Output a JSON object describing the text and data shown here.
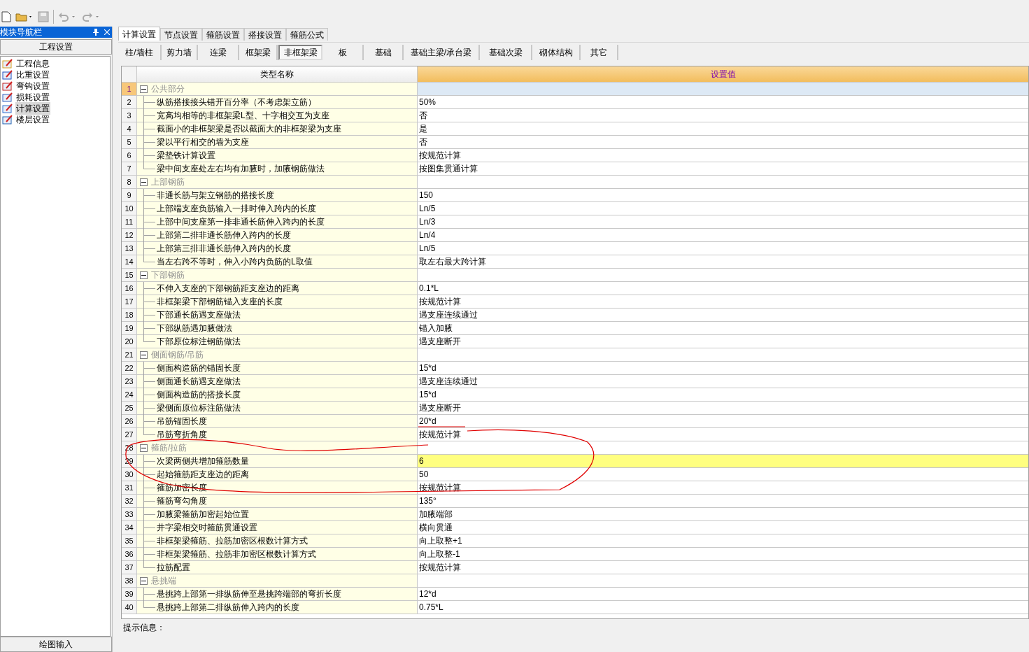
{
  "nav": {
    "title": "模块导航栏",
    "section": "工程设置",
    "items": [
      {
        "label": "工程信息",
        "selected": false
      },
      {
        "label": "比重设置",
        "selected": false
      },
      {
        "label": "弯钩设置",
        "selected": false
      },
      {
        "label": "损耗设置",
        "selected": false
      },
      {
        "label": "计算设置",
        "selected": true
      },
      {
        "label": "楼层设置",
        "selected": false
      }
    ],
    "bottom": "绘图输入"
  },
  "tabs": [
    {
      "label": "计算设置",
      "selected": true
    },
    {
      "label": "节点设置",
      "selected": false
    },
    {
      "label": "箍筋设置",
      "selected": false
    },
    {
      "label": "搭接设置",
      "selected": false
    },
    {
      "label": "箍筋公式",
      "selected": false
    }
  ],
  "subtabs": [
    {
      "label": "柱/墙柱",
      "selected": false
    },
    {
      "label": "剪力墙",
      "selected": false
    },
    {
      "label": "连梁",
      "selected": false
    },
    {
      "label": "框架梁",
      "selected": false
    },
    {
      "label": "非框架梁",
      "selected": true
    },
    {
      "label": "板",
      "selected": false
    },
    {
      "label": "基础",
      "selected": false
    },
    {
      "label": "基础主梁/承台梁",
      "selected": false
    },
    {
      "label": "基础次梁",
      "selected": false
    },
    {
      "label": "砌体结构",
      "selected": false
    },
    {
      "label": "其它",
      "selected": false
    }
  ],
  "grid": {
    "columns": [
      "类型名称",
      "设置值"
    ],
    "groups": [
      {
        "num": "1",
        "name": "公共部分",
        "expanded": true,
        "selected": true,
        "children": [
          {
            "num": "2",
            "name": "纵筋搭接接头错开百分率（不考虑架立筋）",
            "value": "50%",
            "selected": false
          },
          {
            "num": "3",
            "name": "宽高均相等的非框架梁L型、十字相交互为支座",
            "value": "否",
            "selected": false
          },
          {
            "num": "4",
            "name": "截面小的非框架梁是否以截面大的非框架梁为支座",
            "value": "是",
            "selected": false
          },
          {
            "num": "5",
            "name": "梁以平行相交的墙为支座",
            "value": "否",
            "selected": false
          },
          {
            "num": "6",
            "name": "梁垫铁计算设置",
            "value": "按规范计算",
            "selected": false
          },
          {
            "num": "7",
            "name": "梁中间支座处左右均有加腋时，加腋钢筋做法",
            "value": "按图集贯通计算",
            "selected": false
          }
        ]
      },
      {
        "num": "8",
        "name": "上部钢筋",
        "expanded": true,
        "selected": false,
        "children": [
          {
            "num": "9",
            "name": "非通长筋与架立钢筋的搭接长度",
            "value": "150",
            "selected": false
          },
          {
            "num": "10",
            "name": "上部端支座负筋输入一排时伸入跨内的长度",
            "value": "Ln/5",
            "selected": false
          },
          {
            "num": "11",
            "name": "上部中间支座第一排非通长筋伸入跨内的长度",
            "value": "Ln/3",
            "selected": false
          },
          {
            "num": "12",
            "name": "上部第二排非通长筋伸入跨内的长度",
            "value": "Ln/4",
            "selected": false
          },
          {
            "num": "13",
            "name": "上部第三排非通长筋伸入跨内的长度",
            "value": "Ln/5",
            "selected": false
          },
          {
            "num": "14",
            "name": "当左右跨不等时，伸入小跨内负筋的L取值",
            "value": "取左右最大跨计算",
            "selected": false
          }
        ]
      },
      {
        "num": "15",
        "name": "下部钢筋",
        "expanded": true,
        "selected": false,
        "children": [
          {
            "num": "16",
            "name": "不伸入支座的下部钢筋距支座边的距离",
            "value": "0.1*L",
            "selected": false
          },
          {
            "num": "17",
            "name": "非框架梁下部钢筋锚入支座的长度",
            "value": "按规范计算",
            "selected": false
          },
          {
            "num": "18",
            "name": "下部通长筋遇支座做法",
            "value": "遇支座连续通过",
            "selected": false
          },
          {
            "num": "19",
            "name": "下部纵筋遇加腋做法",
            "value": "锚入加腋",
            "selected": false
          },
          {
            "num": "20",
            "name": "下部原位标注钢筋做法",
            "value": "遇支座断开",
            "selected": false
          }
        ]
      },
      {
        "num": "21",
        "name": "侧面钢筋/吊筋",
        "expanded": true,
        "selected": false,
        "children": [
          {
            "num": "22",
            "name": "侧面构造筋的锚固长度",
            "value": "15*d",
            "selected": false
          },
          {
            "num": "23",
            "name": "侧面通长筋遇支座做法",
            "value": "遇支座连续通过",
            "selected": false
          },
          {
            "num": "24",
            "name": "侧面构造筋的搭接长度",
            "value": "15*d",
            "selected": false
          },
          {
            "num": "25",
            "name": "梁侧面原位标注筋做法",
            "value": "遇支座断开",
            "selected": false
          },
          {
            "num": "26",
            "name": "吊筋锚固长度",
            "value": "20*d",
            "selected": false
          },
          {
            "num": "27",
            "name": "吊筋弯折角度",
            "value": "按规范计算",
            "selected": false
          }
        ]
      },
      {
        "num": "28",
        "name": "箍筋/拉筋",
        "expanded": true,
        "selected": false,
        "children": [
          {
            "num": "29",
            "name": "次梁两侧共增加箍筋数量",
            "value": "6",
            "selected": true
          },
          {
            "num": "30",
            "name": "起始箍筋距支座边的距离",
            "value": "50",
            "selected": false
          },
          {
            "num": "31",
            "name": "箍筋加密长度",
            "value": "按规范计算",
            "selected": false
          },
          {
            "num": "32",
            "name": "箍筋弯勾角度",
            "value": "135°",
            "selected": false
          },
          {
            "num": "33",
            "name": "加腋梁箍筋加密起始位置",
            "value": "加腋端部",
            "selected": false
          },
          {
            "num": "34",
            "name": "井字梁相交时箍筋贯通设置",
            "value": "横向贯通",
            "selected": false
          },
          {
            "num": "35",
            "name": "非框架梁箍筋、拉筋加密区根数计算方式",
            "value": "向上取整+1",
            "selected": false
          },
          {
            "num": "36",
            "name": "非框架梁箍筋、拉筋非加密区根数计算方式",
            "value": "向上取整-1",
            "selected": false
          },
          {
            "num": "37",
            "name": "拉筋配置",
            "value": "按规范计算",
            "selected": false
          }
        ]
      },
      {
        "num": "38",
        "name": "悬挑端",
        "expanded": true,
        "selected": false,
        "children": [
          {
            "num": "39",
            "name": "悬挑跨上部第一排纵筋伸至悬挑跨端部的弯折长度",
            "value": "12*d",
            "selected": false
          },
          {
            "num": "40",
            "name": "悬挑跨上部第二排纵筋伸入跨内的长度",
            "value": "0.75*L",
            "selected": false
          }
        ]
      }
    ]
  },
  "hint": "提示信息："
}
